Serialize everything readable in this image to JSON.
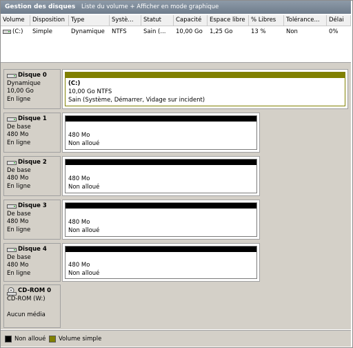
{
  "title": {
    "app": "Gestion des disques",
    "view": "Liste du volume + Afficher en mode graphique"
  },
  "volume_table": {
    "columns": [
      "Volume",
      "Disposition",
      "Type",
      "Systè...",
      "Statut",
      "Capacité",
      "Espace libre",
      "% Libres",
      "Tolérance...",
      "Délai"
    ],
    "rows": [
      [
        "(C:)",
        "Simple",
        "Dynamique",
        "NTFS",
        "Sain (...",
        "10,00 Go",
        "1,25 Go",
        "13 %",
        "Non",
        "0%"
      ]
    ]
  },
  "disks": [
    {
      "name": "Disque 0",
      "type": "Dynamique",
      "size": "10,00 Go",
      "status": "En ligne",
      "partition": {
        "title": "(C:)",
        "line1": "10,00 Go NTFS",
        "line2": "Sain (Système, Démarrer, Vidage sur incident)"
      }
    },
    {
      "name": "Disque 1",
      "type": "De base",
      "size": "480 Mo",
      "status": "En ligne",
      "partition": {
        "title": "",
        "line1": "480 Mo",
        "line2": "Non alloué"
      }
    },
    {
      "name": "Disque 2",
      "type": "De base",
      "size": "480 Mo",
      "status": "En ligne",
      "partition": {
        "title": "",
        "line1": "480 Mo",
        "line2": "Non alloué"
      }
    },
    {
      "name": "Disque 3",
      "type": "De base",
      "size": "480 Mo",
      "status": "En ligne",
      "partition": {
        "title": "",
        "line1": "480 Mo",
        "line2": "Non alloué"
      }
    },
    {
      "name": "Disque 4",
      "type": "De base",
      "size": "480 Mo",
      "status": "En ligne",
      "partition": {
        "title": "",
        "line1": "480 Mo",
        "line2": "Non alloué"
      }
    }
  ],
  "cdrom": {
    "name": "CD-ROM 0",
    "drive": "CD-ROM (W:)",
    "status": "Aucun média"
  },
  "legend": [
    {
      "label": "Non alloué",
      "color": "#000000"
    },
    {
      "label": "Volume simple",
      "color": "#808000"
    }
  ],
  "colors": {
    "simple_volume": "#808000",
    "unallocated": "#000000",
    "titlebar": "#7b8898"
  }
}
